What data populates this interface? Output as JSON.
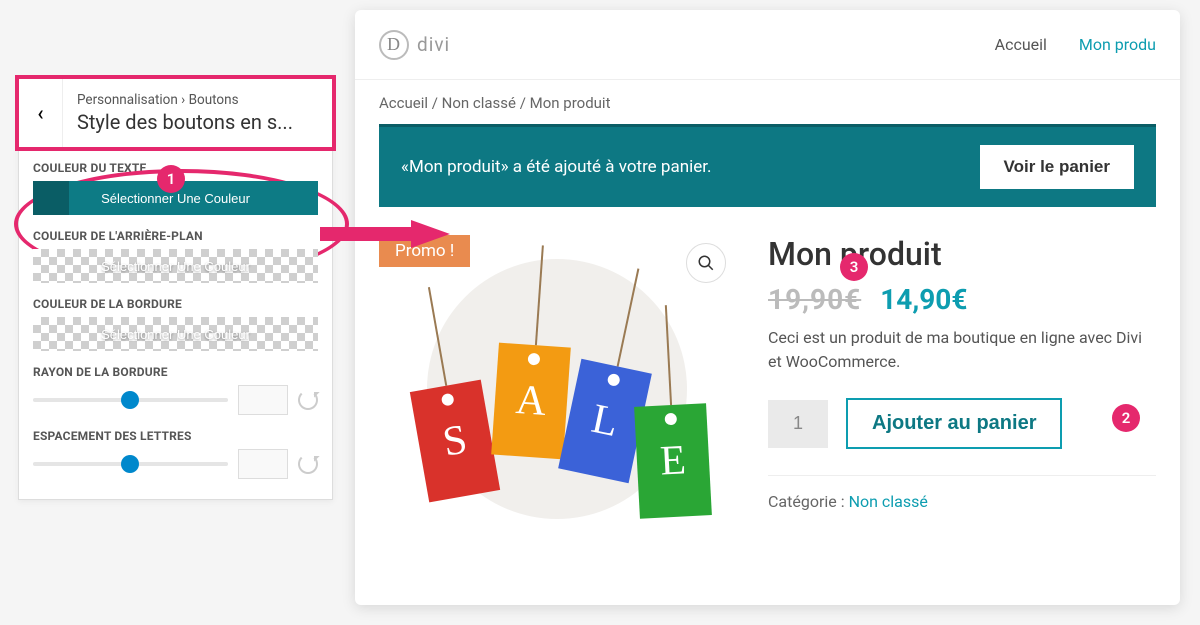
{
  "sidebar": {
    "breadcrumb": [
      "Personnalisation",
      "Boutons"
    ],
    "title": "Style des boutons en s...",
    "sections": {
      "text_color": {
        "label": "COULEUR DU TEXTE",
        "button": "Sélectionner Une Couleur"
      },
      "bg_color": {
        "label": "COULEUR DE L'ARRIÈRE-PLAN",
        "button": "Sélectionner Une Couleur"
      },
      "border_color": {
        "label": "COULEUR DE LA BORDURE",
        "button": "Sélectionner Une Couleur"
      },
      "radius": {
        "label": "RAYON DE LA BORDURE"
      },
      "spacing": {
        "label": "ESPACEMENT DES LETTRES"
      }
    }
  },
  "preview": {
    "logo": "divi",
    "nav": {
      "home": "Accueil",
      "product": "Mon produ"
    },
    "crumbs": "Accueil / Non classé / Mon produit",
    "banner": {
      "msg": "«Mon produit» a été ajouté à votre panier.",
      "btn": "Voir le panier"
    },
    "promo": "Promo !",
    "sale_letters": [
      "S",
      "A",
      "L",
      "E"
    ],
    "product": {
      "title": "Mon produit",
      "price_old": "19,90€",
      "price_new": "14,90€",
      "desc": "Ceci est un produit de ma boutique en ligne avec Divi et WooCommerce.",
      "qty": "1",
      "add": "Ajouter au panier",
      "cat_label": "Catégorie : ",
      "cat_link": "Non classé"
    }
  },
  "callouts": {
    "n1": "1",
    "n2": "2",
    "n3": "3"
  }
}
